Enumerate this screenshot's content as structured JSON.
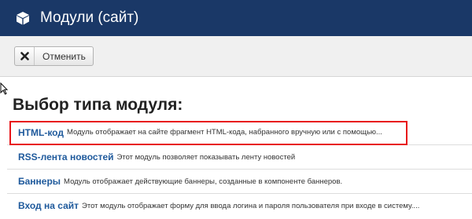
{
  "header": {
    "title": "Модули (сайт)",
    "icon": "cube-icon",
    "background": "#1a3867"
  },
  "toolbar": {
    "cancel_label": "Отменить",
    "cancel_icon": "close-icon"
  },
  "heading": "Выбор типа модуля:",
  "modules": [
    {
      "name": "HTML-код",
      "description": "Модуль отображает на сайте фрагмент HTML-кода, набранного вручную или с помощью..."
    },
    {
      "name": "RSS-лента новостей",
      "description": "Этот модуль позволяет показывать ленту новостей"
    },
    {
      "name": "Баннеры",
      "description": "Модуль отображает действующие баннеры, созданные в компоненте баннеров."
    },
    {
      "name": "Вход на сайт",
      "description": "Этот модуль отображает форму для ввода логина и пароля пользователя при входе в систему...."
    }
  ],
  "highlight_color": "#e8161a",
  "link_color": "#1f5a9c"
}
